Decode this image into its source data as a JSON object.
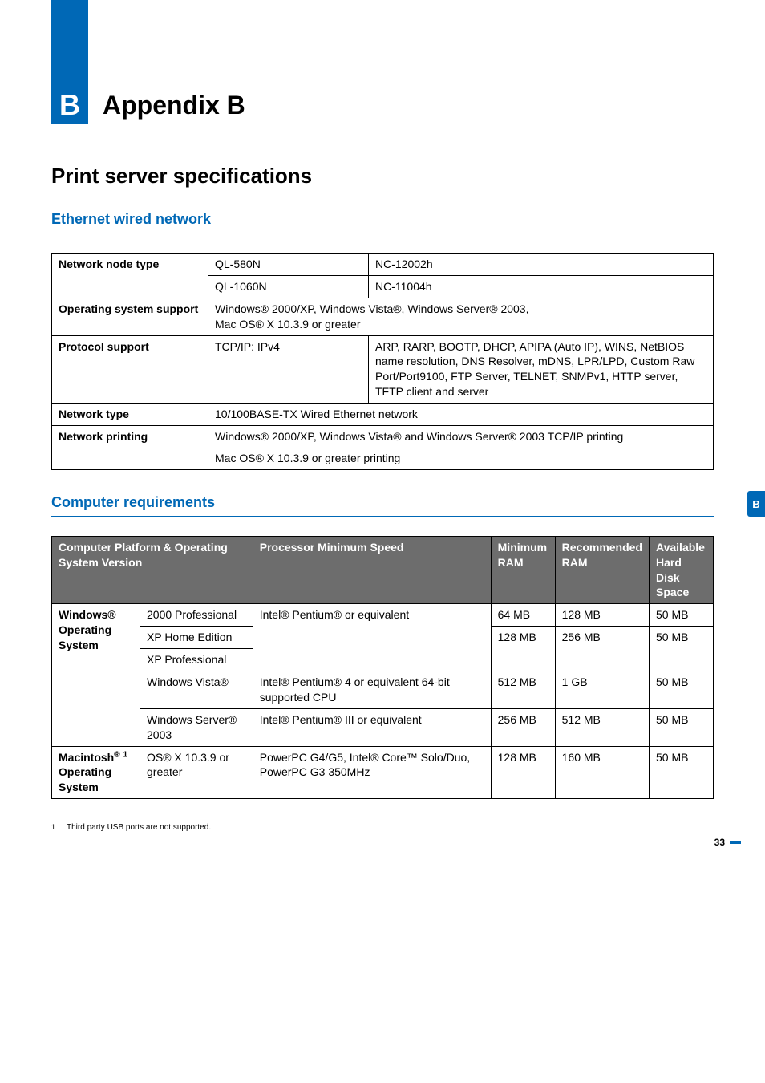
{
  "appendix_letter": "B",
  "appendix_title": "Appendix B",
  "section_title": "Print server specifications",
  "ethernet": {
    "heading": "Ethernet wired network",
    "rows": {
      "node_label": "Network node type",
      "node_r1c1": "QL-580N",
      "node_r1c2": "NC-12002h",
      "node_r2c1": "QL-1060N",
      "node_r2c2": "NC-11004h",
      "os_label": "Operating system support",
      "os_line1": "Windows® 2000/XP, Windows Vista®, Windows Server® 2003,",
      "os_line2": "Mac OS® X 10.3.9 or greater",
      "proto_label": "Protocol support",
      "proto_c1": "TCP/IP: IPv4",
      "proto_c2": "ARP, RARP, BOOTP, DHCP, APIPA (Auto IP), WINS, NetBIOS name resolution, DNS Resolver, mDNS, LPR/LPD, Custom Raw Port/Port9100, FTP Server, TELNET, SNMPv1, HTTP server, TFTP client and server",
      "ntype_label": "Network type",
      "ntype_val": "10/100BASE-TX Wired Ethernet network",
      "nprint_label": "Network printing",
      "nprint_line1": "Windows® 2000/XP, Windows Vista® and Windows Server® 2003 TCP/IP printing",
      "nprint_line2": "Mac OS® X 10.3.9 or greater printing"
    }
  },
  "requirements": {
    "heading": "Computer requirements",
    "head": {
      "c1": "Computer Platform & Operating System Version",
      "c2": "Processor Minimum Speed",
      "c3": "Minimum RAM",
      "c4": "Recommended RAM",
      "c5": "Available Hard Disk Space"
    },
    "win_group": "Windows® Operating System",
    "mac_group": "Macintosh® 1 Operating System",
    "rows": [
      {
        "os": "2000 Professional",
        "cpu": "Intel® Pentium® or equivalent",
        "min": "64 MB",
        "rec": "128 MB",
        "hd": "50 MB"
      },
      {
        "os": "XP Home Edition",
        "cpu": "",
        "min": "128 MB",
        "rec": "256 MB",
        "hd": "50 MB"
      },
      {
        "os": "XP Professional",
        "cpu": "",
        "min": "",
        "rec": "",
        "hd": ""
      },
      {
        "os": "Windows Vista®",
        "cpu": "Intel® Pentium® 4 or equivalent 64-bit supported CPU",
        "min": "512 MB",
        "rec": "1 GB",
        "hd": "50 MB"
      },
      {
        "os": "Windows Server® 2003",
        "cpu": "Intel® Pentium® III or equivalent",
        "min": "256 MB",
        "rec": "512 MB",
        "hd": "50 MB"
      },
      {
        "os": "OS® X 10.3.9 or greater",
        "cpu": "PowerPC G4/G5, Intel® Core™ Solo/Duo, PowerPC G3 350MHz",
        "min": "128 MB",
        "rec": "160 MB",
        "hd": "50 MB"
      }
    ]
  },
  "footnote_num": "1",
  "footnote_text": "Third party USB ports are not supported.",
  "page_number": "33",
  "side_tab": "B"
}
